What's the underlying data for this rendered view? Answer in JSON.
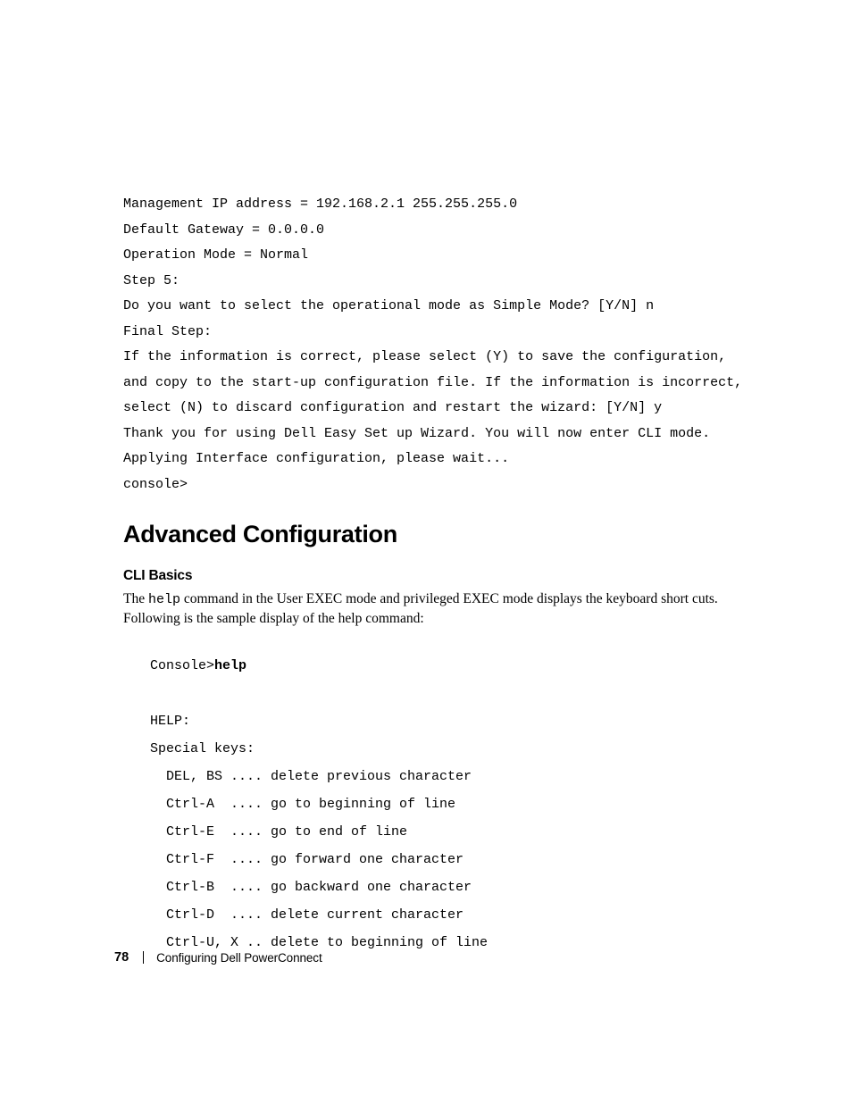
{
  "console": {
    "line1": "Management IP address = 192.168.2.1 255.255.255.0",
    "line2": "Default Gateway = 0.0.0.0",
    "line3": "Operation Mode = Normal",
    "line4": "Step 5:",
    "line5": "Do you want to select the operational mode as Simple Mode? [Y/N] n",
    "line6": "Final Step:",
    "line7": "If the information is correct, please select (Y) to save the configuration, and copy to the start-up configuration file. If the information is incorrect, select (N) to discard configuration and restart the wizard: [Y/N] y",
    "line8": "Thank you for using Dell Easy Set up Wizard. You will now enter CLI mode.",
    "line9": "Applying Interface configuration, please wait...",
    "line10": "console>"
  },
  "heading1": "Advanced Configuration",
  "heading2": "CLI Basics",
  "para_prefix": "The ",
  "para_code": "help",
  "para_suffix": " command in the User EXEC mode and privileged EXEC mode displays the keyboard short cuts. Following is the sample display of the help command:",
  "help": {
    "prompt_prefix": "Console>",
    "prompt_cmd": "help",
    "blank1": "",
    "l1": "HELP:",
    "l2": "Special keys:",
    "l3": "  DEL, BS .... delete previous character",
    "l4": "  Ctrl-A  .... go to beginning of line",
    "l5": "  Ctrl-E  .... go to end of line",
    "l6": "  Ctrl-F  .... go forward one character",
    "l7": "  Ctrl-B  .... go backward one character",
    "l8": "  Ctrl-D  .... delete current character",
    "l9": "  Ctrl-U, X .. delete to beginning of line"
  },
  "footer": {
    "page": "78",
    "chapter": "Configuring Dell PowerConnect"
  }
}
